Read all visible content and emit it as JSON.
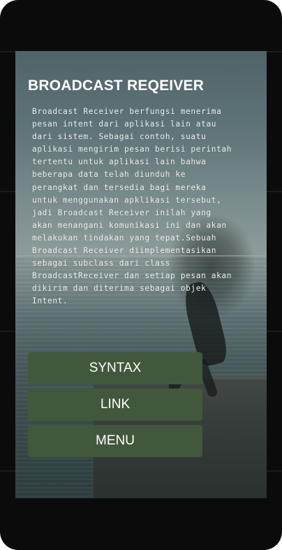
{
  "screen": {
    "title": "BROADCAST REQEIVER",
    "description": "Broadcast Receiver berfungsi menerima pesan intent dari aplikasi lain atau dari sistem. Sebagai contoh, suatu aplikasi mengirim pesan berisi perintah tertentu untuk aplikasi lain bahwa beberapa data telah diunduh ke perangkat dan tersedia bagi mereka untuk menggunakan apklikasi tersebut, jadi Broadcast Receiver inilah yang akan menangani komunikasi ini dan akan melakukan tindakan yang tepat.Sebuah Broadcast Receiver diimplementasikan sebagai subclass dari class BroadcastReceiver dan setiap pesan akan dikirim dan diterima sebagai objek Intent."
  },
  "buttons": {
    "syntax_label": "SYNTAX",
    "link_label": "LINK",
    "menu_label": "MENU"
  },
  "colors": {
    "button_bg": "#41583d",
    "device_frame": "#0b0b0b"
  }
}
